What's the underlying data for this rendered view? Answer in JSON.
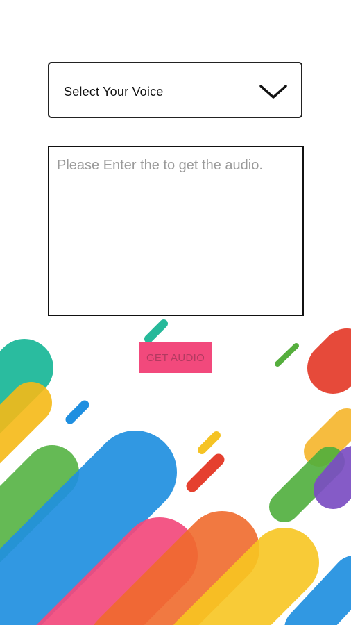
{
  "voice_select": {
    "label": "Select Your Voice",
    "icon": "chevron-down-icon"
  },
  "text_input": {
    "placeholder": "Please Enter the to get the audio.",
    "value": ""
  },
  "get_audio_button": {
    "label": "GET AUDIO",
    "color": "#f2497c"
  },
  "background": {
    "style": "colorful diagonal pill-shaped stripes",
    "colors": [
      "#26b99a",
      "#f7c325",
      "#5cb947",
      "#1e90e1",
      "#f2497c",
      "#f16a2e",
      "#e53935",
      "#7e57c2",
      "#f5a623"
    ]
  }
}
